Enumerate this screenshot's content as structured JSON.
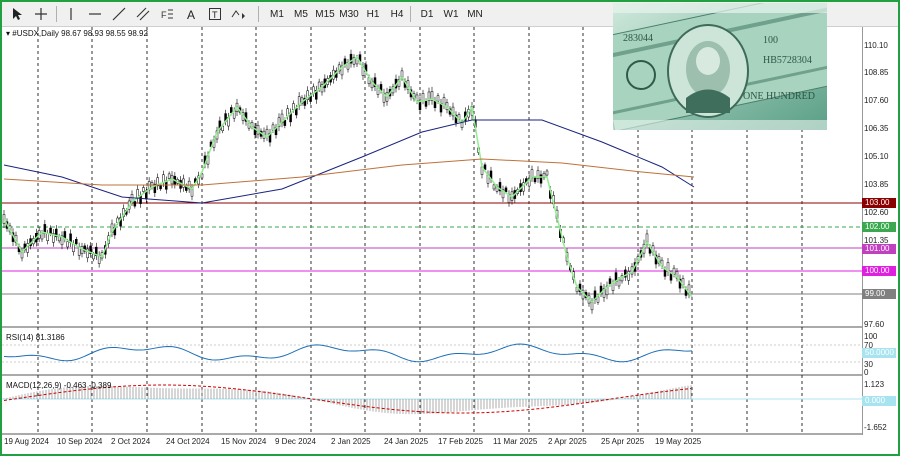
{
  "toolbar": {
    "timeframes": [
      "M1",
      "M5",
      "M15",
      "M30",
      "H1",
      "H4",
      "D1",
      "W1",
      "MN"
    ],
    "icons": [
      "cursor-icon",
      "crosshair-icon",
      "vertical-line-icon",
      "horizontal-line-icon",
      "trendline-icon",
      "channel-icon",
      "fibonacci-icon",
      "text-icon",
      "label-icon",
      "shapes-icon"
    ]
  },
  "chart": {
    "symbol_header": "#USDX,Daily  98.67 98.93 98.55 98.92",
    "price_levels": [
      "110.10",
      "108.85",
      "107.60",
      "106.35",
      "105.10",
      "103.85",
      "102.60",
      "101.35",
      "97.60"
    ],
    "level_tags": [
      {
        "label": "103.00",
        "color": "#8b0000"
      },
      {
        "label": "102.00",
        "color": "#3aa84f"
      },
      {
        "label": "101.00",
        "color": "#c040c0"
      },
      {
        "label": "100.00",
        "color": "#e020e0"
      },
      {
        "label": "99.00",
        "color": "#808080"
      }
    ],
    "dates": [
      "19 Aug 2024",
      "10 Sep 2024",
      "2 Oct 2024",
      "24 Oct 2024",
      "15 Nov 2024",
      "9 Dec 2024",
      "2 Jan 2025",
      "24 Jan 2025",
      "17 Feb 2025",
      "11 Mar 2025",
      "2 Apr 2025",
      "25 Apr 2025",
      "19 May 2025"
    ]
  },
  "rsi": {
    "header": "RSI(14) 81.3186",
    "levels": [
      "100",
      "70",
      "30",
      "0"
    ],
    "tag": "50.0000"
  },
  "macd": {
    "header": "MACD(12,26,9) -0.463 -0.389",
    "levels": [
      "1.123",
      "-1.652"
    ],
    "tag": "0.000"
  },
  "photo": {
    "caption": "USD banknotes"
  }
}
